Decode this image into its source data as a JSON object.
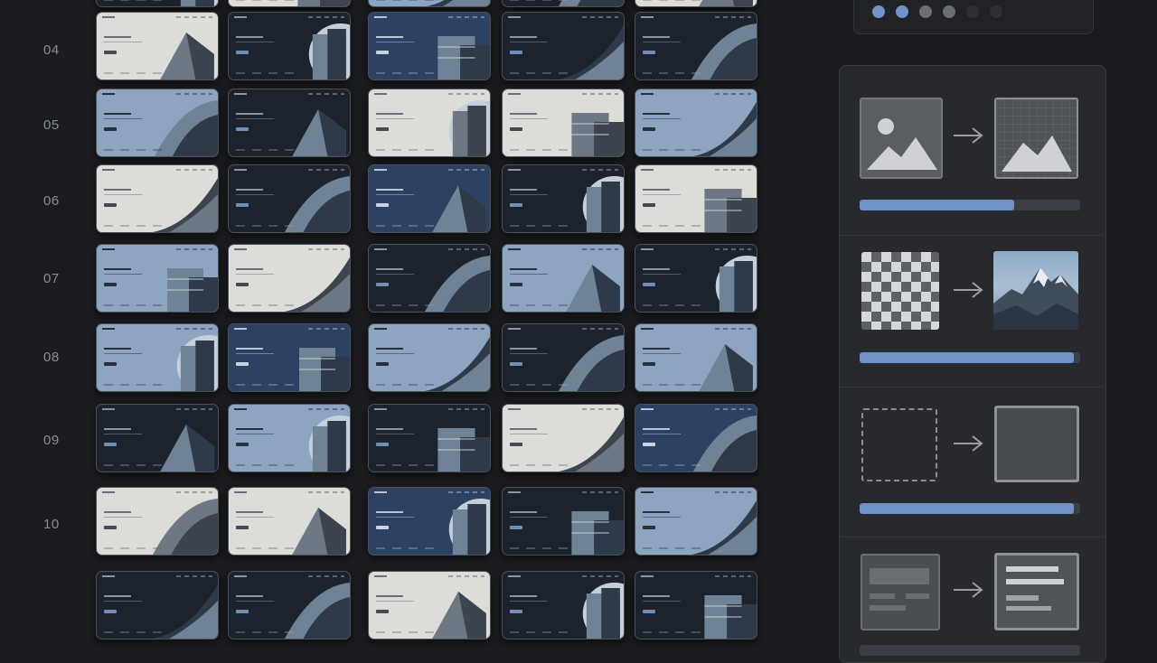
{
  "gallery": {
    "row_labels": [
      "04",
      "05",
      "06",
      "07",
      "08",
      "09",
      "10"
    ]
  },
  "sidebar": {
    "pager_dots": [
      "active",
      "active",
      "inactive",
      "inactive",
      "faint",
      "faint"
    ],
    "steps": [
      {
        "name": "image-to-grid",
        "from_icon": "image-icon",
        "to_icon": "grid-image-icon",
        "progress": 0.7
      },
      {
        "name": "transparency-to-photo",
        "from_icon": "checkerboard-icon",
        "to_icon": "mountain-photo-icon",
        "progress": 0.97
      },
      {
        "name": "placeholder-to-frame",
        "from_icon": "dashed-frame-icon",
        "to_icon": "solid-frame-icon",
        "progress": 0.97
      },
      {
        "name": "wireframe-to-layout",
        "from_icon": "wireframe-icon",
        "to_icon": "layout-icon",
        "progress": 0.0
      }
    ]
  },
  "colors": {
    "accent": "#6f93c7",
    "background": "#1b1c1f",
    "panel": "#27292d"
  }
}
